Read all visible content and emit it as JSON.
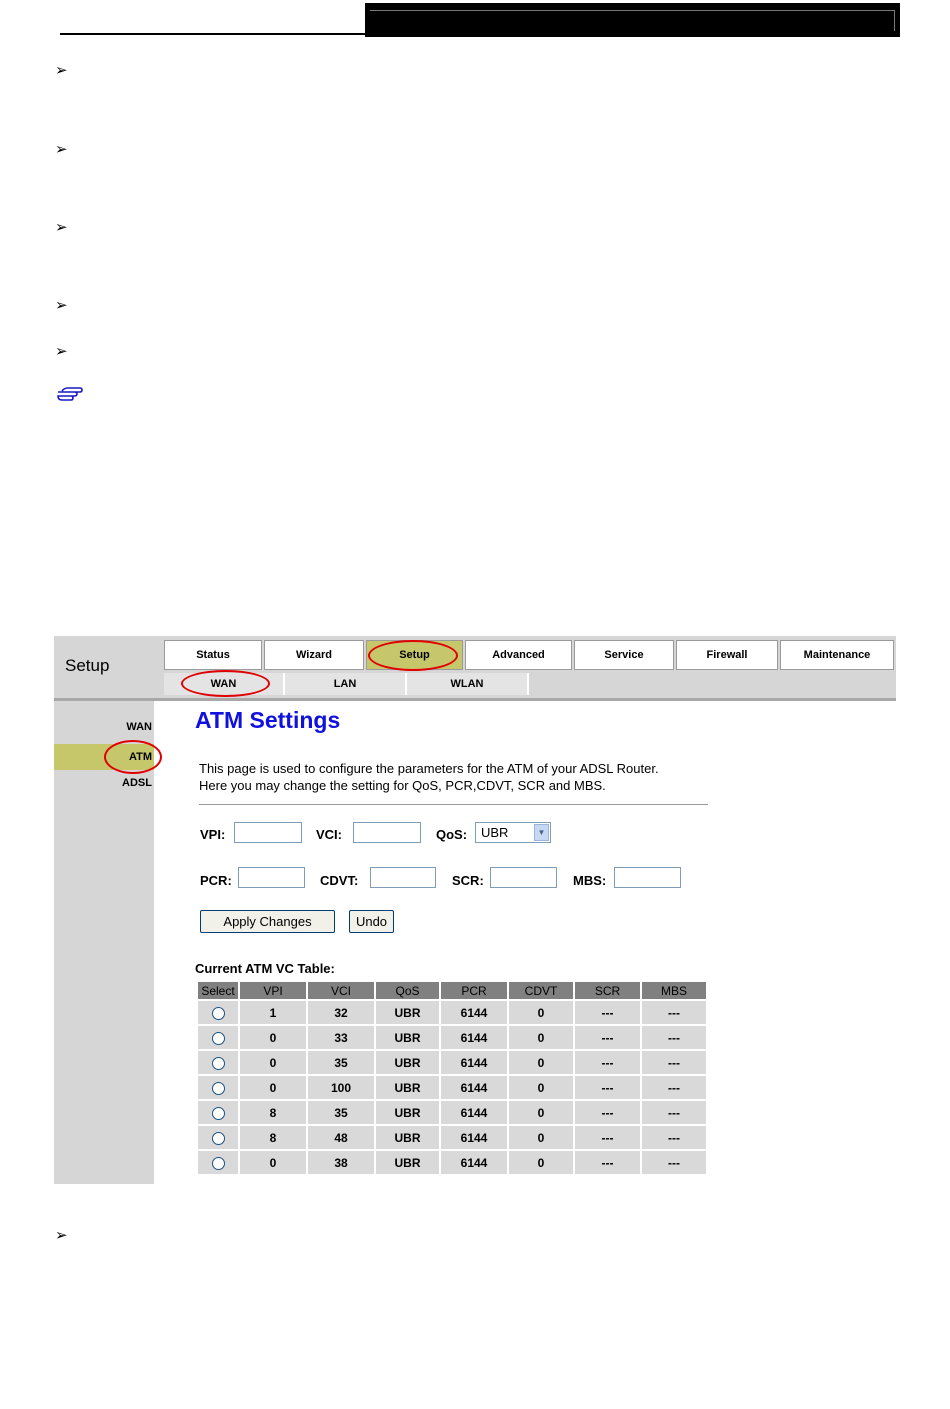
{
  "bullets": [
    "➢",
    "➢",
    "➢",
    "➢",
    "➢",
    "➢"
  ],
  "note_icon": "pointing-hand-icon",
  "setup_title": "Setup",
  "tabs": [
    {
      "label": "Status",
      "active": false
    },
    {
      "label": "Wizard",
      "active": false
    },
    {
      "label": "Setup",
      "active": true
    },
    {
      "label": "Advanced",
      "active": false
    },
    {
      "label": "Service",
      "active": false
    },
    {
      "label": "Firewall",
      "active": false
    },
    {
      "label": "Maintenance",
      "active": false
    }
  ],
  "subtabs": [
    "WAN",
    "LAN",
    "WLAN"
  ],
  "sidebar": [
    "WAN",
    "ATM",
    "ADSL"
  ],
  "page_title": "ATM Settings",
  "description": [
    "This page is used to configure the parameters for the ATM of your ADSL Router.",
    "Here you may change the setting for QoS, PCR,CDVT, SCR and MBS."
  ],
  "form": {
    "vpi_label": "VPI:",
    "vci_label": "VCI:",
    "qos_label": "QoS:",
    "qos_value": "UBR",
    "pcr_label": "PCR:",
    "cdvt_label": "CDVT:",
    "scr_label": "SCR:",
    "mbs_label": "MBS:",
    "vpi": "",
    "vci": "",
    "pcr": "",
    "cdvt": "",
    "scr": "",
    "mbs": ""
  },
  "buttons": {
    "apply": "Apply Changes",
    "undo": "Undo"
  },
  "table": {
    "caption": "Current ATM VC Table:",
    "headers": [
      "Select",
      "VPI",
      "VCI",
      "QoS",
      "PCR",
      "CDVT",
      "SCR",
      "MBS"
    ],
    "rows": [
      [
        "1",
        "32",
        "UBR",
        "6144",
        "0",
        "---",
        "---"
      ],
      [
        "0",
        "33",
        "UBR",
        "6144",
        "0",
        "---",
        "---"
      ],
      [
        "0",
        "35",
        "UBR",
        "6144",
        "0",
        "---",
        "---"
      ],
      [
        "0",
        "100",
        "UBR",
        "6144",
        "0",
        "---",
        "---"
      ],
      [
        "8",
        "35",
        "UBR",
        "6144",
        "0",
        "---",
        "---"
      ],
      [
        "8",
        "48",
        "UBR",
        "6144",
        "0",
        "---",
        "---"
      ],
      [
        "0",
        "38",
        "UBR",
        "6144",
        "0",
        "---",
        "---"
      ]
    ]
  },
  "colors": {
    "active": "#c6c76b",
    "title": "#1010e0",
    "highlight_oval": "#e00000"
  }
}
